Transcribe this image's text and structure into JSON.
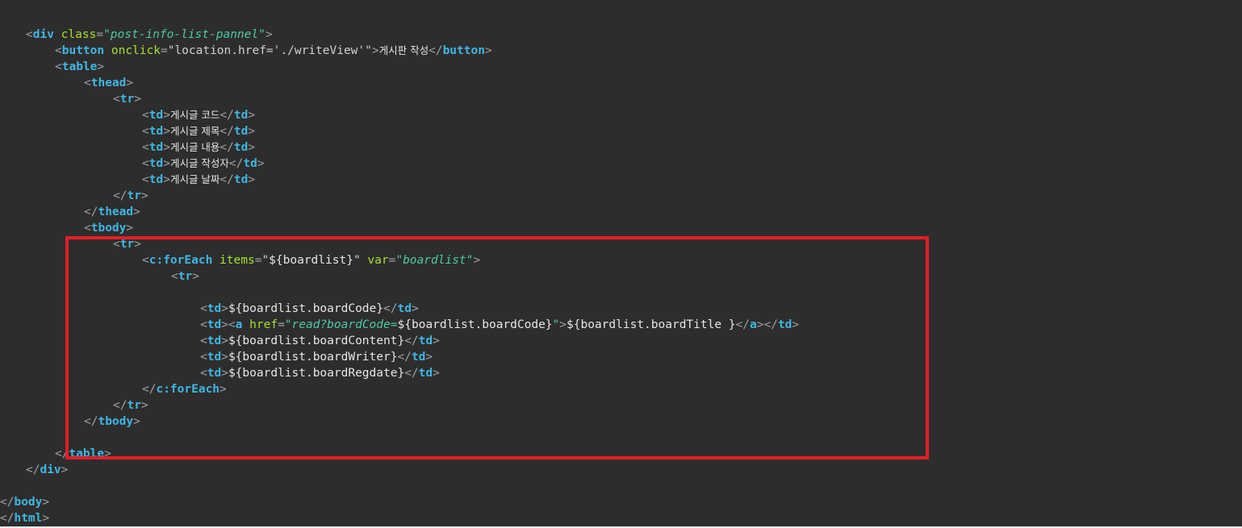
{
  "editor": {
    "lines": [
      {
        "indent": 32,
        "tokens": [
          [
            "p",
            "<"
          ],
          [
            "tg",
            "div"
          ],
          [
            "tx",
            " "
          ],
          [
            "an",
            "class"
          ],
          [
            "p",
            "="
          ],
          [
            "av",
            "\"post-info-list-pannel\""
          ],
          [
            "p",
            ">"
          ]
        ]
      },
      {
        "indent": 68,
        "tokens": [
          [
            "p",
            "<"
          ],
          [
            "tg",
            "button"
          ],
          [
            "tx",
            " "
          ],
          [
            "an",
            "onclick"
          ],
          [
            "p",
            "="
          ],
          [
            "sq",
            "\"location.href='./writeView'\""
          ],
          [
            "p",
            ">"
          ],
          [
            "tx ko",
            "게시판 작성"
          ],
          [
            "p",
            "</"
          ],
          [
            "tg",
            "button"
          ],
          [
            "p",
            ">"
          ]
        ]
      },
      {
        "indent": 68,
        "tokens": [
          [
            "p",
            "<"
          ],
          [
            "tg",
            "table"
          ],
          [
            "p",
            ">"
          ]
        ]
      },
      {
        "indent": 104,
        "tokens": [
          [
            "p",
            "<"
          ],
          [
            "tg",
            "thead"
          ],
          [
            "p",
            ">"
          ]
        ]
      },
      {
        "indent": 140,
        "tokens": [
          [
            "p",
            "<"
          ],
          [
            "tg",
            "tr"
          ],
          [
            "p",
            ">"
          ]
        ]
      },
      {
        "indent": 176,
        "tokens": [
          [
            "p",
            "<"
          ],
          [
            "tg",
            "td"
          ],
          [
            "p",
            ">"
          ],
          [
            "tx ko",
            "게시글 코드"
          ],
          [
            "p",
            "</"
          ],
          [
            "tg",
            "td"
          ],
          [
            "p",
            ">"
          ]
        ]
      },
      {
        "indent": 176,
        "tokens": [
          [
            "p",
            "<"
          ],
          [
            "tg",
            "td"
          ],
          [
            "p",
            ">"
          ],
          [
            "tx ko",
            "게시글 제목"
          ],
          [
            "p",
            "</"
          ],
          [
            "tg",
            "td"
          ],
          [
            "p",
            ">"
          ]
        ]
      },
      {
        "indent": 176,
        "tokens": [
          [
            "p",
            "<"
          ],
          [
            "tg",
            "td"
          ],
          [
            "p",
            ">"
          ],
          [
            "tx ko",
            "게시글 내용"
          ],
          [
            "p",
            "</"
          ],
          [
            "tg",
            "td"
          ],
          [
            "p",
            ">"
          ]
        ]
      },
      {
        "indent": 176,
        "tokens": [
          [
            "p",
            "<"
          ],
          [
            "tg",
            "td"
          ],
          [
            "p",
            ">"
          ],
          [
            "tx ko",
            "게시글 작성자"
          ],
          [
            "p",
            "</"
          ],
          [
            "tg",
            "td"
          ],
          [
            "p",
            ">"
          ]
        ]
      },
      {
        "indent": 176,
        "tokens": [
          [
            "p",
            "<"
          ],
          [
            "tg",
            "td"
          ],
          [
            "p",
            ">"
          ],
          [
            "tx ko",
            "게시글 날짜"
          ],
          [
            "p",
            "</"
          ],
          [
            "tg",
            "td"
          ],
          [
            "p",
            ">"
          ]
        ]
      },
      {
        "indent": 140,
        "tokens": [
          [
            "p",
            "</"
          ],
          [
            "tg",
            "tr"
          ],
          [
            "p",
            ">"
          ]
        ]
      },
      {
        "indent": 104,
        "tokens": [
          [
            "p",
            "</"
          ],
          [
            "tg",
            "thead"
          ],
          [
            "p",
            ">"
          ]
        ]
      },
      {
        "indent": 104,
        "tokens": [
          [
            "p",
            "<"
          ],
          [
            "tg",
            "tbody"
          ],
          [
            "p",
            ">"
          ]
        ]
      },
      {
        "indent": 140,
        "tokens": [
          [
            "p",
            "<"
          ],
          [
            "tg",
            "tr"
          ],
          [
            "p",
            ">"
          ]
        ]
      },
      {
        "indent": 176,
        "tokens": [
          [
            "p",
            "<"
          ],
          [
            "tg",
            "c:forEach"
          ],
          [
            "tx",
            " "
          ],
          [
            "an",
            "items"
          ],
          [
            "p",
            "="
          ],
          [
            "sq",
            "\""
          ],
          [
            "el",
            "${boardlist}"
          ],
          [
            "sq",
            "\""
          ],
          [
            "tx",
            " "
          ],
          [
            "an",
            "var"
          ],
          [
            "p",
            "="
          ],
          [
            "av",
            "\"boardlist\""
          ],
          [
            "p",
            ">"
          ]
        ]
      },
      {
        "indent": 212,
        "tokens": [
          [
            "p",
            "<"
          ],
          [
            "tg",
            "tr"
          ],
          [
            "p",
            ">"
          ]
        ]
      },
      {
        "indent": 0,
        "tokens": []
      },
      {
        "indent": 248,
        "tokens": [
          [
            "p",
            "<"
          ],
          [
            "tg",
            "td"
          ],
          [
            "p",
            ">"
          ],
          [
            "el",
            "${boardlist.boardCode}"
          ],
          [
            "p",
            "</"
          ],
          [
            "tg",
            "td"
          ],
          [
            "p",
            ">"
          ]
        ]
      },
      {
        "indent": 248,
        "tokens": [
          [
            "p",
            "<"
          ],
          [
            "tg",
            "td"
          ],
          [
            "p",
            "><"
          ],
          [
            "tg",
            "a"
          ],
          [
            "tx",
            " "
          ],
          [
            "an",
            "href"
          ],
          [
            "p",
            "="
          ],
          [
            "av",
            "\"read?boardCode="
          ],
          [
            "el",
            "${boardlist.boardCode}"
          ],
          [
            "av",
            "\""
          ],
          [
            "p",
            ">"
          ],
          [
            "el",
            "${boardlist.boardTitle }"
          ],
          [
            "p",
            "</"
          ],
          [
            "tg",
            "a"
          ],
          [
            "p",
            "></"
          ],
          [
            "tg",
            "td"
          ],
          [
            "p",
            ">"
          ]
        ]
      },
      {
        "indent": 248,
        "tokens": [
          [
            "p",
            "<"
          ],
          [
            "tg",
            "td"
          ],
          [
            "p",
            ">"
          ],
          [
            "el",
            "${boardlist.boardContent}"
          ],
          [
            "p",
            "</"
          ],
          [
            "tg",
            "td"
          ],
          [
            "p",
            ">"
          ]
        ]
      },
      {
        "indent": 248,
        "tokens": [
          [
            "p",
            "<"
          ],
          [
            "tg",
            "td"
          ],
          [
            "p",
            ">"
          ],
          [
            "el",
            "${boardlist.boardWriter}"
          ],
          [
            "p",
            "</"
          ],
          [
            "tg",
            "td"
          ],
          [
            "p",
            ">"
          ]
        ]
      },
      {
        "indent": 248,
        "tokens": [
          [
            "p",
            "<"
          ],
          [
            "tg",
            "td"
          ],
          [
            "p",
            ">"
          ],
          [
            "el",
            "${boardlist.boardRegdate}"
          ],
          [
            "p",
            "</"
          ],
          [
            "tg",
            "td"
          ],
          [
            "p",
            ">"
          ]
        ]
      },
      {
        "indent": 176,
        "tokens": [
          [
            "p",
            "</"
          ],
          [
            "tg",
            "c:forEach"
          ],
          [
            "p",
            ">"
          ]
        ]
      },
      {
        "indent": 140,
        "tokens": [
          [
            "p",
            "</"
          ],
          [
            "tg",
            "tr"
          ],
          [
            "p",
            ">"
          ]
        ]
      },
      {
        "indent": 104,
        "tokens": [
          [
            "p",
            "</"
          ],
          [
            "tg",
            "tbody"
          ],
          [
            "p",
            ">"
          ]
        ]
      },
      {
        "indent": 0,
        "tokens": []
      },
      {
        "indent": 68,
        "tokens": [
          [
            "p",
            "</"
          ],
          [
            "tg",
            "table"
          ],
          [
            "p",
            ">"
          ]
        ]
      },
      {
        "indent": 32,
        "tokens": [
          [
            "p",
            "</"
          ],
          [
            "tg",
            "div"
          ],
          [
            "p",
            ">"
          ]
        ]
      },
      {
        "indent": 0,
        "tokens": []
      },
      {
        "indent": 0,
        "tokens": [
          [
            "p",
            "</"
          ],
          [
            "tg",
            "body"
          ],
          [
            "p",
            ">"
          ]
        ]
      },
      {
        "indent": 0,
        "tokens": [
          [
            "p",
            "</"
          ],
          [
            "tg",
            "html"
          ],
          [
            "p",
            ">"
          ]
        ]
      }
    ]
  },
  "colors": {
    "background": "#2d2d2d",
    "tag": "#3fb6e3",
    "attribute_name": "#a6e22e",
    "attribute_value": "#4ec9a6",
    "highlight_border": "#e21e26"
  }
}
